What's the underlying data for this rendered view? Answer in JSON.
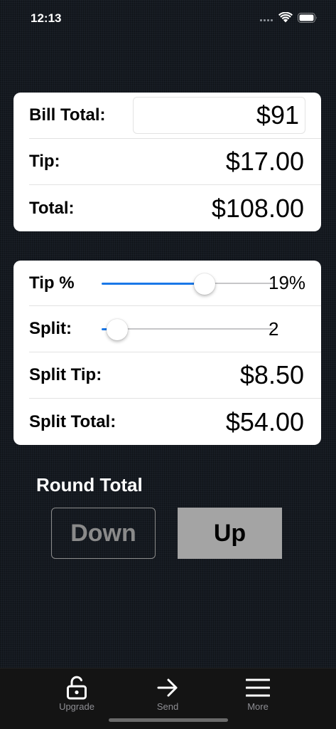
{
  "status_bar": {
    "time": "12:13"
  },
  "bill_card": {
    "bill_total_label": "Bill Total:",
    "bill_total_value": "$91",
    "tip_label": "Tip:",
    "tip_value": "$17.00",
    "total_label": "Total:",
    "total_value": "$108.00"
  },
  "split_card": {
    "tip_percent_label": "Tip %",
    "tip_percent_value": "19%",
    "tip_slider_fraction": 0.6,
    "split_label": "Split:",
    "split_value": "2",
    "split_slider_fraction": 0.09,
    "split_tip_label": "Split Tip:",
    "split_tip_value": "$8.50",
    "split_total_label": "Split Total:",
    "split_total_value": "$54.00"
  },
  "round_total": {
    "label": "Round Total",
    "down_label": "Down",
    "up_label": "Up"
  },
  "tab_bar": {
    "items": [
      {
        "label": "Upgrade",
        "icon": "unlock-icon"
      },
      {
        "label": "Send",
        "icon": "arrow-right-icon"
      },
      {
        "label": "More",
        "icon": "hamburger-menu-icon"
      }
    ]
  },
  "colors": {
    "slider_fill": "#1a78e8",
    "up_button_bg": "#a4a4a4",
    "background": "#151a21"
  }
}
